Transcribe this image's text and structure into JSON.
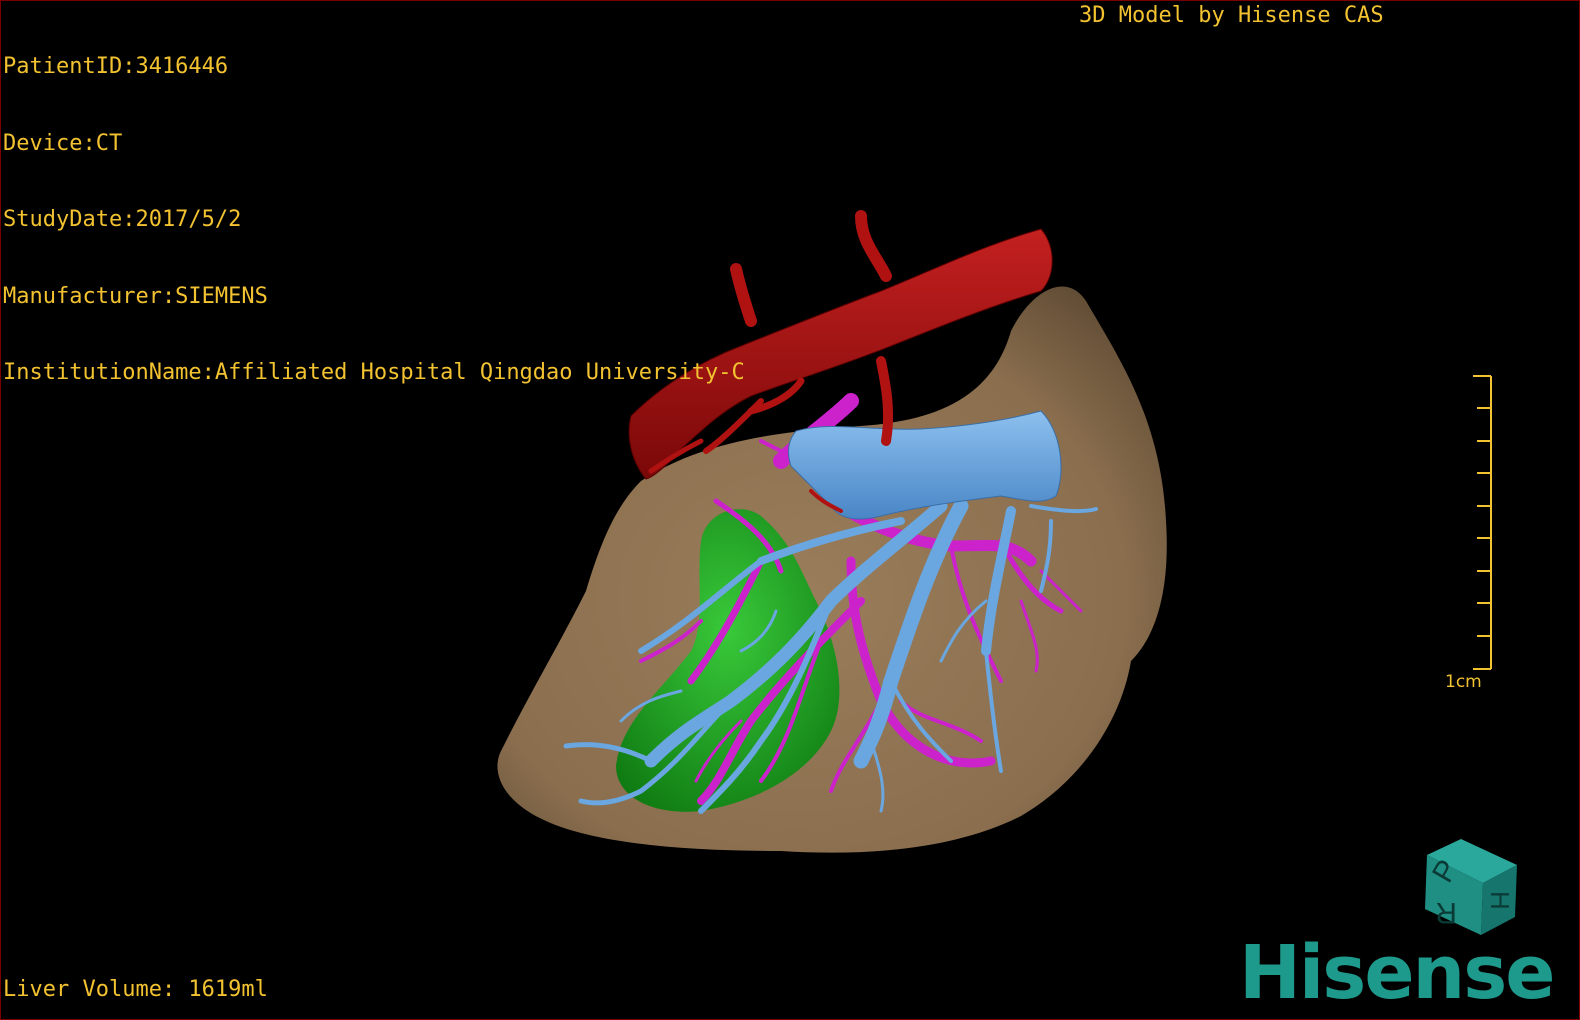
{
  "viewer": {
    "info_lines": [
      "PatientID:3416446",
      "Device:CT",
      "StudyDate:2017/5/2",
      "Manufacturer:SIEMENS",
      "InstitutionName:Affiliated Hospital Qingdao University-C"
    ],
    "brand_title": "3D Model by Hisense CAS",
    "volume_text": "Liver Volume: 1619ml",
    "scale_bar_label": "1cm",
    "logo_text": "Hisense",
    "orientation_cube_letters": [
      "P",
      "H",
      "R"
    ]
  },
  "colors": {
    "text_accent": "#f2c230",
    "liver": "#8f7453",
    "artery": "#b01212",
    "portal_vein": "#cc22cc",
    "hepatic_vein": "#6aa6df",
    "gallbladder": "#1da81d",
    "logo": "#1e9a8c",
    "frame": "#7a0000"
  }
}
